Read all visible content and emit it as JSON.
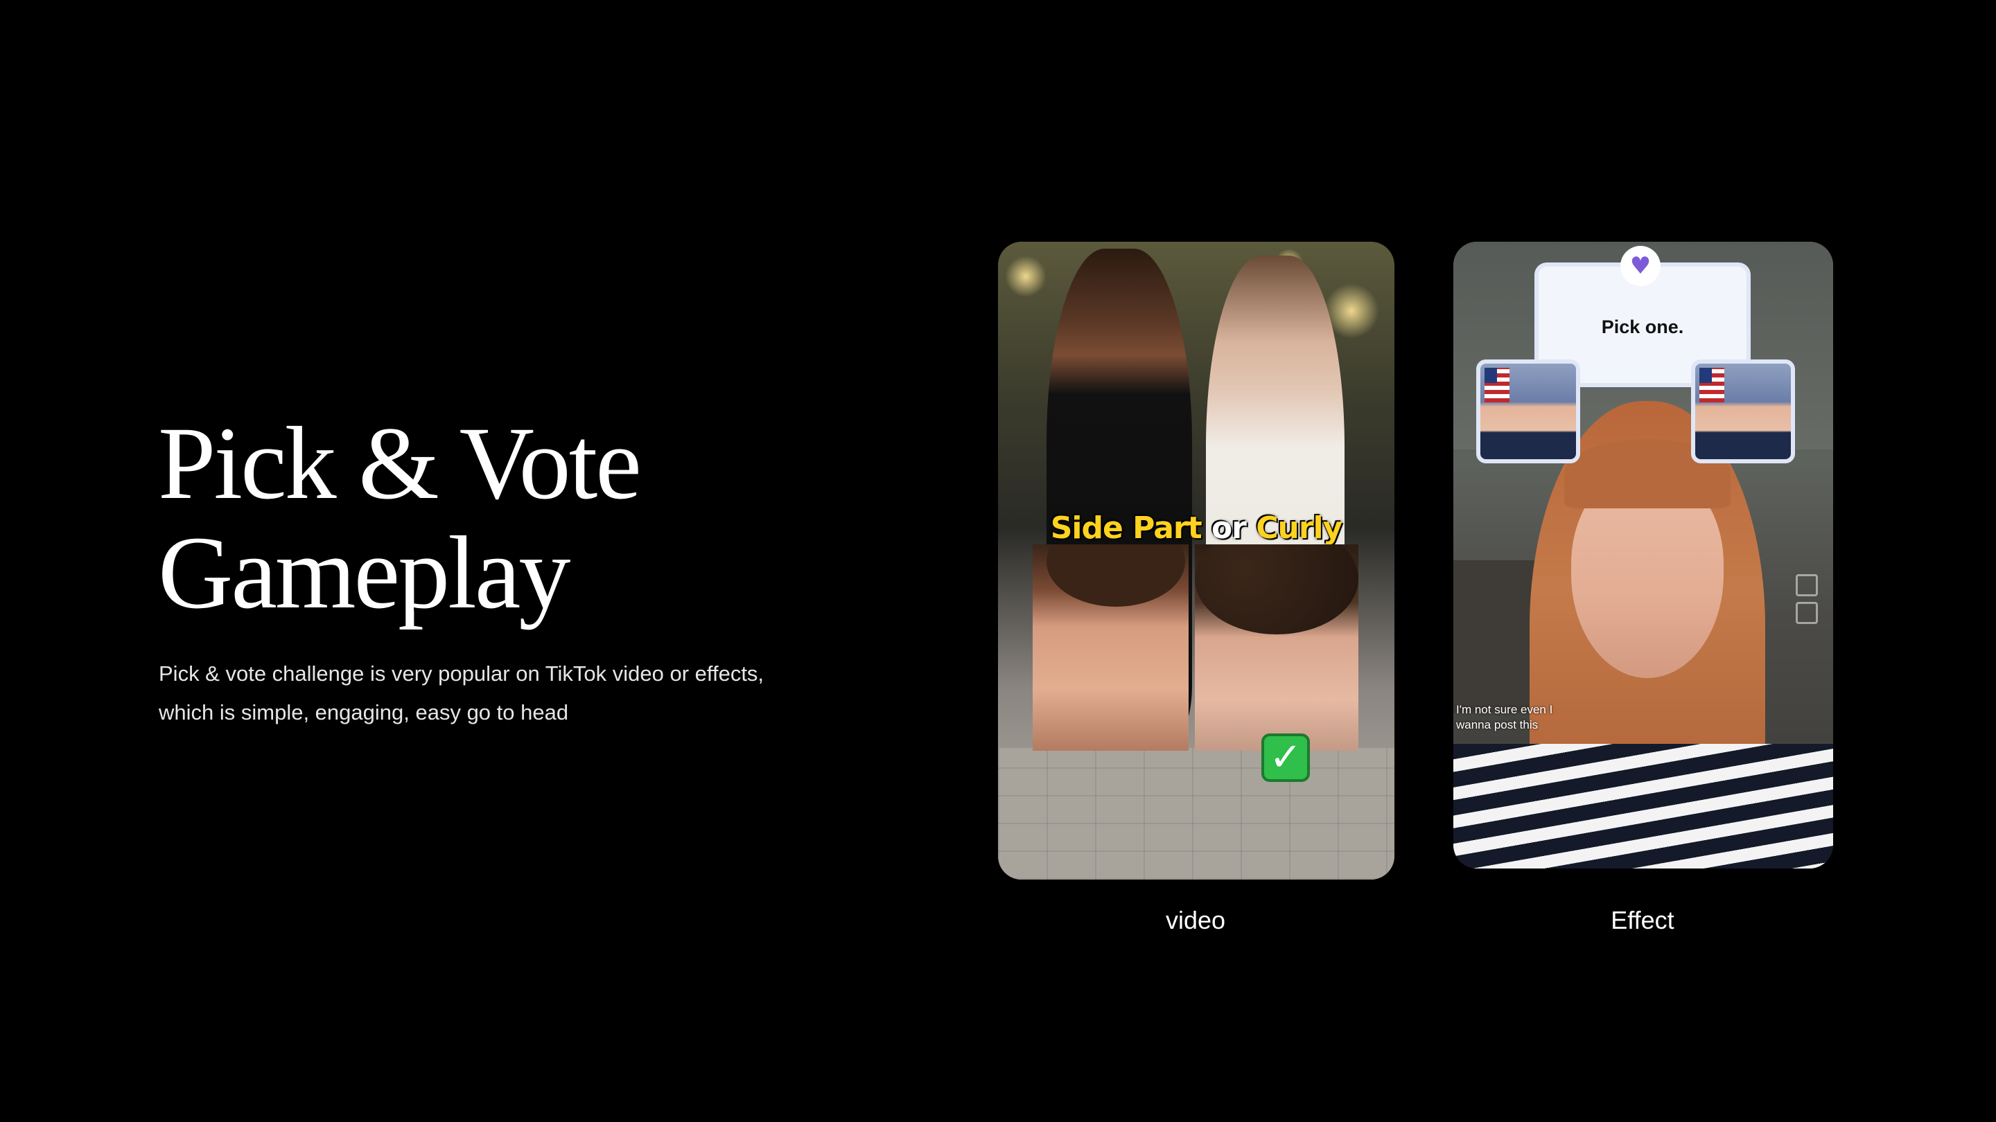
{
  "heading": {
    "line1": "Pick & Vote",
    "line2": "Gameplay"
  },
  "description": {
    "line1": "Pick & vote challenge is very popular on TikTok video or effects,",
    "line2": "which is simple, engaging, easy go to head"
  },
  "video_example": {
    "overlay_title_a": "Side Part",
    "overlay_title_or": " or ",
    "overlay_title_b": "Curly",
    "check_mark": "✓",
    "caption": "video"
  },
  "effect_example": {
    "prompt": "Pick one.",
    "heart_icon": "♥",
    "overlay_line1": "I'm not sure even I",
    "overlay_line2": "wanna post this",
    "caption": "Effect"
  },
  "colors": {
    "background": "#000000",
    "title_yellow": "#ffd21f",
    "accent_purple": "#7b5cd6"
  }
}
